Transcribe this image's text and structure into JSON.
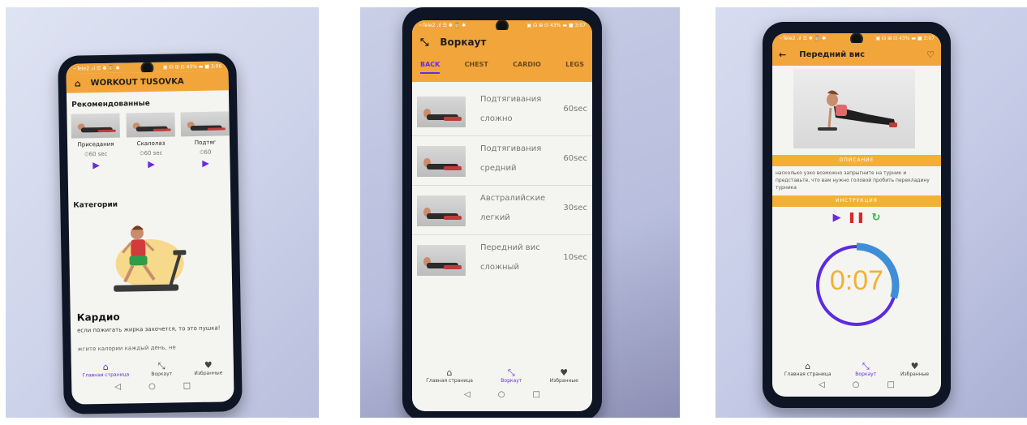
{
  "photo1": {
    "status_left": "~Tele2 .ıl ☰ ✽ ⌛ ✱",
    "status_right": "▣ ☊ ⊞ ⊡ 43% ▬ ■ 3:06",
    "app_title": "WORKOUT TUSOVKA",
    "recommended_title": "Рекомендованные",
    "recommended": [
      {
        "name": "Приседания",
        "time": "60 sec"
      },
      {
        "name": "Скалолаз",
        "time": "60 sec"
      },
      {
        "name": "Подтяг",
        "time": "60"
      }
    ],
    "categories_title": "Категории",
    "category_name": "Кардио",
    "category_desc": "если пожигать жирка захочется, то это пушка!",
    "category_desc2": "жгите калории каждый день, не",
    "nav": [
      {
        "label": "Главная страница",
        "icon": "home-icon"
      },
      {
        "label": "Воркаут",
        "icon": "workout-icon"
      },
      {
        "label": "Избранные",
        "icon": "heart-icon"
      }
    ]
  },
  "photo2": {
    "status_left": "~Tele2 .ıl ☰ ✽ ⌛ ✱",
    "status_right": "▣ ☊ ⊞ ⊡ 43% ▬ ■ 3:07",
    "app_title": "Воркаут",
    "tabs": [
      "BACK",
      "CHEST",
      "CARDIO",
      "LEGS"
    ],
    "exercises": [
      {
        "name": "Подтягивания",
        "level": "сложно",
        "time": "60sec"
      },
      {
        "name": "Подтягивания",
        "level": "средний",
        "time": "60sec"
      },
      {
        "name": "Австралийские",
        "level": "легкий",
        "time": "30sec"
      },
      {
        "name": "Передний вис",
        "level": "сложный",
        "time": "10sec"
      }
    ],
    "nav": [
      {
        "label": "Главная страница",
        "icon": "home-icon"
      },
      {
        "label": "Воркаут",
        "icon": "workout-icon"
      },
      {
        "label": "Избранные",
        "icon": "heart-icon"
      }
    ]
  },
  "photo3": {
    "status_left": "~Tele2 .ıl ☰ ✽ ⌛ ✱",
    "status_right": "▣ ☊ ⊞ ⊡ 43% ▬ ■ 3:07",
    "app_title": "Передний вис",
    "description_label": "ОПИСАНИЕ",
    "description_text": "насколько узко возможно запрыгните на турник и представьте, что вам нужно головой пробить перекладину турника",
    "instruction_label": "ИНСТРУКЦИЯ",
    "timer": "0:07",
    "timer_progress": 0.3,
    "colors": {
      "timer_text": "#f2b134",
      "ring_main": "#5b2be0",
      "ring_accent": "#3f8fd8"
    },
    "nav": [
      {
        "label": "Главная страница",
        "icon": "home-icon"
      },
      {
        "label": "Воркаут",
        "icon": "workout-icon"
      },
      {
        "label": "Избранные",
        "icon": "heart-icon"
      }
    ]
  }
}
